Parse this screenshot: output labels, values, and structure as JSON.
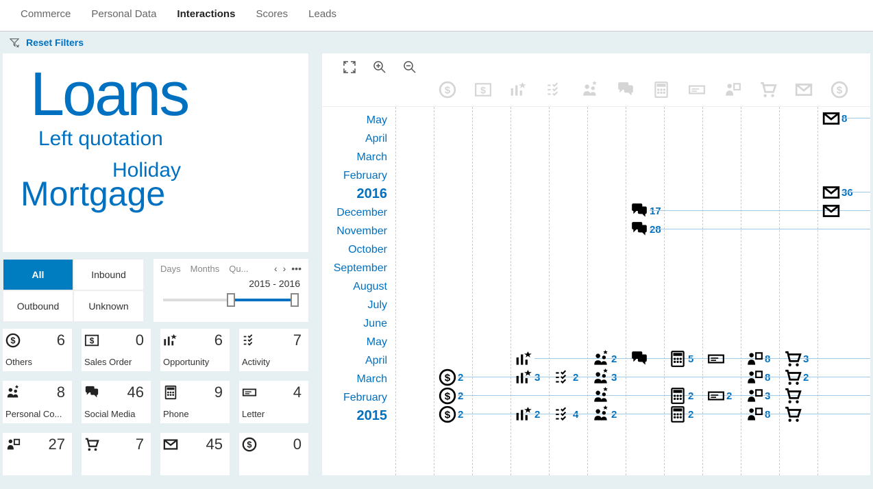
{
  "nav": {
    "items": [
      "Commerce",
      "Personal Data",
      "Interactions",
      "Scores",
      "Leads"
    ],
    "active": 2
  },
  "filters": {
    "reset": "Reset Filters"
  },
  "word_cloud": {
    "w1": "Loans",
    "w2": "Left quotation",
    "w3": "Holiday",
    "w4": "Mortgage"
  },
  "direction_filter": {
    "options": [
      "All",
      "Inbound",
      "Outbound",
      "Unknown"
    ],
    "active": 0
  },
  "time_filter": {
    "scales": [
      "Days",
      "Months",
      "Qu..."
    ],
    "range": "2015 - 2016",
    "more": "…"
  },
  "tiles": [
    {
      "icon": "dollar",
      "label": "Others",
      "count": 6
    },
    {
      "icon": "dollar-box",
      "label": "Sales Order",
      "count": 0
    },
    {
      "icon": "chart-star",
      "label": "Opportunity",
      "count": 6
    },
    {
      "icon": "checklist",
      "label": "Activity",
      "count": 7
    },
    {
      "icon": "people-star",
      "label": "Personal Co...",
      "count": 8
    },
    {
      "icon": "chat",
      "label": "Social Media",
      "count": 46
    },
    {
      "icon": "calc",
      "label": "Phone",
      "count": 9
    },
    {
      "icon": "label",
      "label": "Letter",
      "count": 4
    },
    {
      "icon": "people-box",
      "label": "",
      "count": 27
    },
    {
      "icon": "cart",
      "label": "",
      "count": 7
    },
    {
      "icon": "mail",
      "label": "",
      "count": 45
    },
    {
      "icon": "dollar",
      "label": "",
      "count": 0
    }
  ],
  "timeline": {
    "months": [
      "May",
      "April",
      "March",
      "February",
      "2016",
      "December",
      "November",
      "October",
      "September",
      "August",
      "July",
      "June",
      "May",
      "April",
      "March",
      "February",
      "2015"
    ],
    "year_rows": [
      4,
      16
    ],
    "events": [
      {
        "row": 0,
        "col": 10,
        "icon": "mail",
        "count": 8
      },
      {
        "row": 4,
        "col": 10,
        "icon": "mail",
        "count": 36
      },
      {
        "row": 5,
        "col": 5,
        "icon": "chat",
        "count": 17
      },
      {
        "row": 5,
        "col": 10,
        "icon": "mail",
        "count": ""
      },
      {
        "row": 6,
        "col": 5,
        "icon": "chat",
        "count": 28
      },
      {
        "row": 13,
        "col": 2,
        "icon": "chart-star",
        "count": ""
      },
      {
        "row": 13,
        "col": 4,
        "icon": "people-star",
        "count": 2
      },
      {
        "row": 13,
        "col": 5,
        "icon": "chat",
        "count": ""
      },
      {
        "row": 13,
        "col": 6,
        "icon": "calc",
        "count": 5
      },
      {
        "row": 13,
        "col": 7,
        "icon": "label",
        "count": ""
      },
      {
        "row": 13,
        "col": 8,
        "icon": "people-box",
        "count": 8
      },
      {
        "row": 13,
        "col": 9,
        "icon": "cart",
        "count": 3
      },
      {
        "row": 14,
        "col": 0,
        "icon": "dollar",
        "count": 2
      },
      {
        "row": 14,
        "col": 2,
        "icon": "chart-star",
        "count": 3
      },
      {
        "row": 14,
        "col": 3,
        "icon": "checklist",
        "count": 2
      },
      {
        "row": 14,
        "col": 4,
        "icon": "people-star",
        "count": 3
      },
      {
        "row": 14,
        "col": 8,
        "icon": "people-box",
        "count": 8
      },
      {
        "row": 14,
        "col": 9,
        "icon": "cart",
        "count": 2
      },
      {
        "row": 15,
        "col": 0,
        "icon": "dollar",
        "count": 2
      },
      {
        "row": 15,
        "col": 4,
        "icon": "people-star",
        "count": ""
      },
      {
        "row": 15,
        "col": 6,
        "icon": "calc",
        "count": 2
      },
      {
        "row": 15,
        "col": 7,
        "icon": "label",
        "count": 2
      },
      {
        "row": 15,
        "col": 8,
        "icon": "people-box",
        "count": 3
      },
      {
        "row": 15,
        "col": 9,
        "icon": "cart",
        "count": ""
      },
      {
        "row": 16,
        "col": 0,
        "icon": "dollar",
        "count": 2
      },
      {
        "row": 16,
        "col": 2,
        "icon": "chart-star",
        "count": 2
      },
      {
        "row": 16,
        "col": 3,
        "icon": "checklist",
        "count": 4
      },
      {
        "row": 16,
        "col": 4,
        "icon": "people-star",
        "count": 2
      },
      {
        "row": 16,
        "col": 6,
        "icon": "calc",
        "count": 2
      },
      {
        "row": 16,
        "col": 8,
        "icon": "people-box",
        "count": 8
      },
      {
        "row": 16,
        "col": 9,
        "icon": "cart",
        "count": ""
      }
    ]
  }
}
